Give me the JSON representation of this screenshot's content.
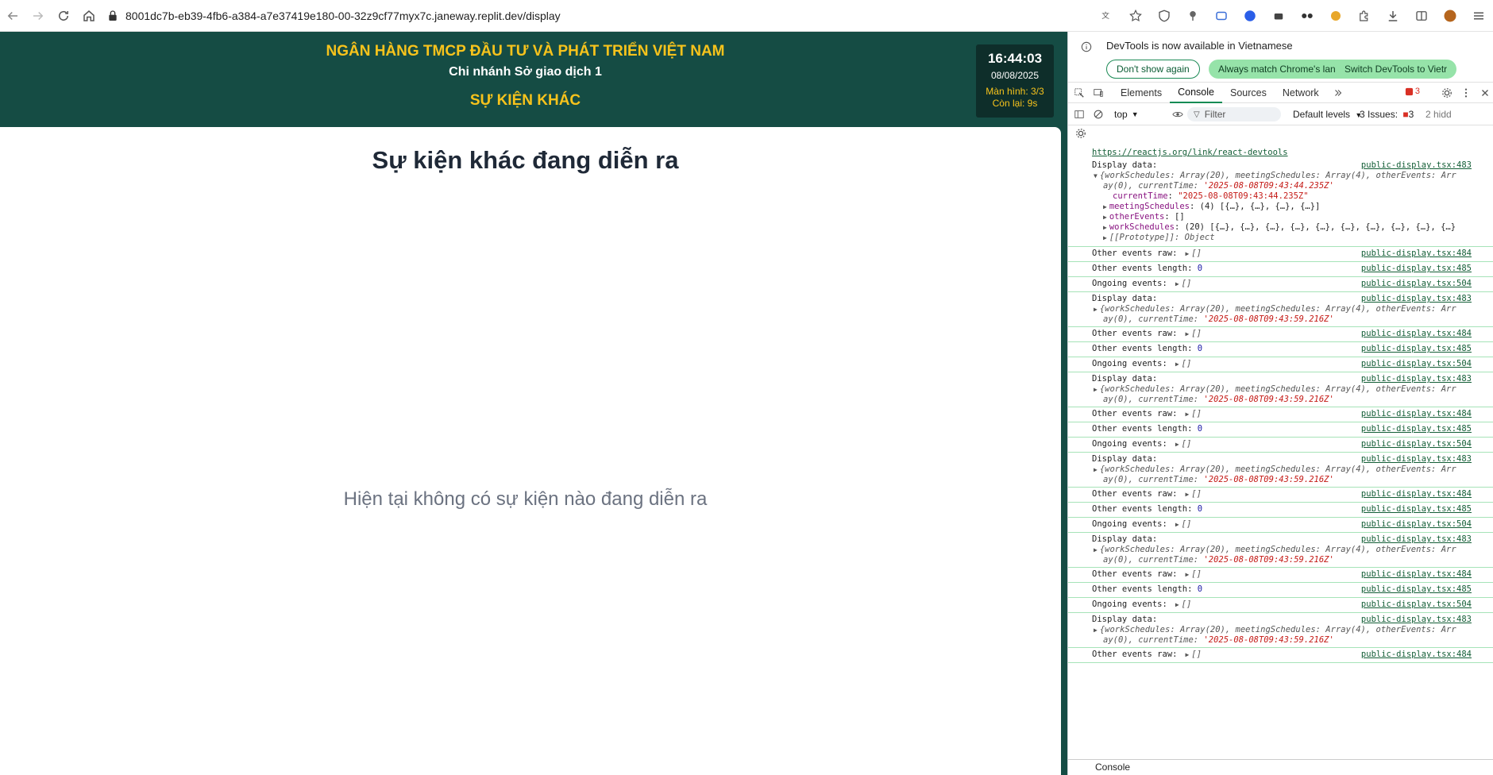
{
  "browser": {
    "url": "8001dc7b-eb39-4fb6-a384-a7e37419e180-00-32z9cf77myx7c.janeway.replit.dev/display"
  },
  "page": {
    "bank_name": "NGÂN HÀNG TMCP ĐẦU TƯ VÀ PHÁT TRIỂN VIỆT NAM",
    "branch_name": "Chi nhánh Sở giao dịch 1",
    "section_title": "SỰ KIỆN KHÁC",
    "clock": {
      "time": "16:44:03",
      "date": "08/08/2025",
      "screen": "Màn hình: 3/3",
      "remaining": "Còn lại: 9s"
    },
    "content_title": "Sự kiện khác đang diễn ra",
    "empty_message": "Hiện tại không có sự kiện nào đang diễn ra",
    "colors": {
      "header_bg": "#154c44",
      "accent_yellow": "#f7c31c"
    }
  },
  "devtools": {
    "banner_text": "DevTools is now available in Vietnamese",
    "btn_dont_show": "Don't show again",
    "btn_match": "Always match Chrome's language",
    "btn_switch": "Switch DevTools to Vietr",
    "tabs": [
      "Elements",
      "Console",
      "Sources",
      "Network"
    ],
    "error_count": "3",
    "context": "top",
    "filter_placeholder": "Filter",
    "levels": "Default levels",
    "issues_label": "3 Issues:",
    "issues_count": "3",
    "hidden_label": "2 hidd",
    "drawer_label": "Console",
    "react_link": "https://reactjs.org/link/react-devtools",
    "expanded_log": {
      "label": "Display data:",
      "src": "public-display.tsx:483",
      "summary_1": "{workSchedules: Array(20), meetingSchedules: Array(4), otherEvents: Arr",
      "summary_2": "ay(0), currentTime: ",
      "summary_time": "'2025-08-08T09:43:44.235Z'",
      "prop_current_key": "currentTime",
      "prop_current_val": "\"2025-08-08T09:43:44.235Z\"",
      "prop_meeting_key": "meetingSchedules",
      "prop_meeting_val": "(4) [{…}, {…}, {…}, {…}]",
      "prop_other_key": "otherEvents",
      "prop_other_val": "[]",
      "prop_work_key": "workSchedules",
      "prop_work_val": "(20) [{…}, {…}, {…}, {…}, {…}, {…}, {…}, {…}, {…}, {…}",
      "prop_proto": "[[Prototype]]: Object"
    },
    "logs": [
      {
        "label": "Other events raw:",
        "value": "[]",
        "src": "public-display.tsx:484"
      },
      {
        "label": "Other events length:",
        "value": "0",
        "src": "public-display.tsx:485"
      },
      {
        "label": "Ongoing events:",
        "value": "[]",
        "src": "public-display.tsx:504"
      },
      {
        "label": "Display data:",
        "src": "public-display.tsx:483",
        "line1": "{workSchedules: Array(20), meetingSchedules: Array(4), otherEvents: Arr",
        "line2": "ay(0), currentTime: ",
        "time": "'2025-08-08T09:43:59.216Z'"
      },
      {
        "label": "Other events raw:",
        "value": "[]",
        "src": "public-display.tsx:484"
      },
      {
        "label": "Other events length:",
        "value": "0",
        "src": "public-display.tsx:485"
      },
      {
        "label": "Ongoing events:",
        "value": "[]",
        "src": "public-display.tsx:504"
      },
      {
        "label": "Display data:",
        "src": "public-display.tsx:483",
        "line1": "{workSchedules: Array(20), meetingSchedules: Array(4), otherEvents: Arr",
        "line2": "ay(0), currentTime: ",
        "time": "'2025-08-08T09:43:59.216Z'"
      },
      {
        "label": "Other events raw:",
        "value": "[]",
        "src": "public-display.tsx:484"
      },
      {
        "label": "Other events length:",
        "value": "0",
        "src": "public-display.tsx:485"
      },
      {
        "label": "Ongoing events:",
        "value": "[]",
        "src": "public-display.tsx:504"
      },
      {
        "label": "Display data:",
        "src": "public-display.tsx:483",
        "line1": "{workSchedules: Array(20), meetingSchedules: Array(4), otherEvents: Arr",
        "line2": "ay(0), currentTime: ",
        "time": "'2025-08-08T09:43:59.216Z'"
      },
      {
        "label": "Other events raw:",
        "value": "[]",
        "src": "public-display.tsx:484"
      },
      {
        "label": "Other events length:",
        "value": "0",
        "src": "public-display.tsx:485"
      },
      {
        "label": "Ongoing events:",
        "value": "[]",
        "src": "public-display.tsx:504"
      },
      {
        "label": "Display data:",
        "src": "public-display.tsx:483",
        "line1": "{workSchedules: Array(20), meetingSchedules: Array(4), otherEvents: Arr",
        "line2": "ay(0), currentTime: ",
        "time": "'2025-08-08T09:43:59.216Z'"
      },
      {
        "label": "Other events raw:",
        "value": "[]",
        "src": "public-display.tsx:484"
      },
      {
        "label": "Other events length:",
        "value": "0",
        "src": "public-display.tsx:485"
      },
      {
        "label": "Ongoing events:",
        "value": "[]",
        "src": "public-display.tsx:504"
      },
      {
        "label": "Display data:",
        "src": "public-display.tsx:483",
        "line1": "{workSchedules: Array(20), meetingSchedules: Array(4), otherEvents: Arr",
        "line2": "ay(0), currentTime: ",
        "time": "'2025-08-08T09:43:59.216Z'"
      },
      {
        "label": "Other events raw:",
        "value": "[]",
        "src": "public-display.tsx:484"
      }
    ]
  }
}
